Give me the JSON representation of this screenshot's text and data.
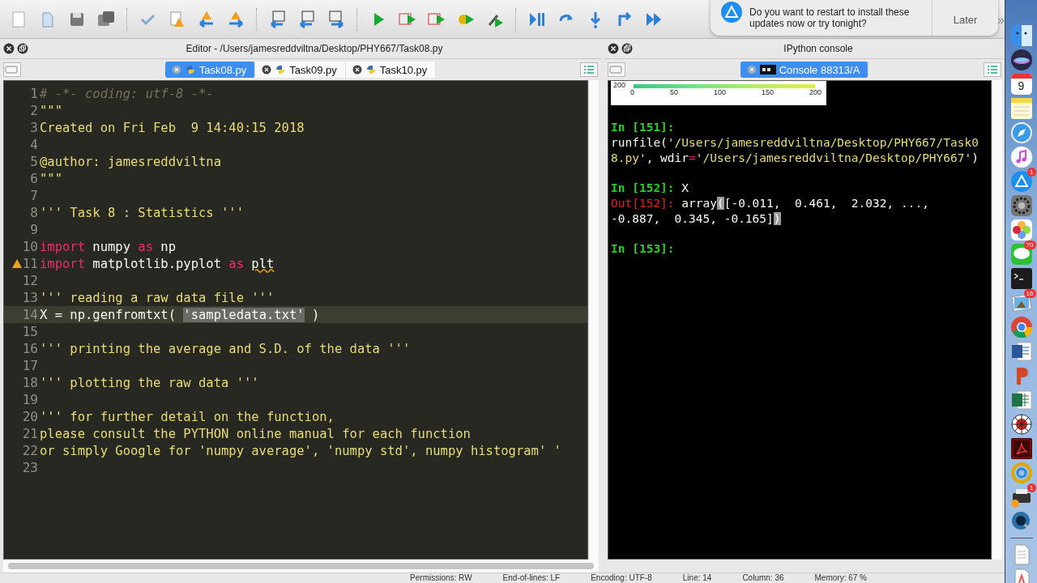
{
  "toolbar": {
    "overflow": "»"
  },
  "notification": {
    "message": "Do you want to restart to install these updates now or try tonight?",
    "button": "Later"
  },
  "editor": {
    "title": "Editor - /Users/jamesreddviltna/Desktop/PHY667/Task08.py",
    "tabs": [
      {
        "label": "Task08.py",
        "selected": true
      },
      {
        "label": "Task09.py",
        "selected": false
      },
      {
        "label": "Task10.py",
        "selected": false
      }
    ],
    "lines": [
      {
        "number": "1",
        "warning": false,
        "current": false,
        "segments": [
          {
            "kind": "comment",
            "text": "# -*- coding: utf-8 -*-"
          }
        ]
      },
      {
        "number": "2",
        "warning": false,
        "current": false,
        "segments": [
          {
            "kind": "string",
            "text": "\"\"\""
          }
        ]
      },
      {
        "number": "3",
        "warning": false,
        "current": false,
        "segments": [
          {
            "kind": "string",
            "text": "Created on Fri Feb  9 14:40:15 2018"
          }
        ]
      },
      {
        "number": "4",
        "warning": false,
        "current": false
      },
      {
        "number": "5",
        "warning": false,
        "current": false,
        "segments": [
          {
            "kind": "string",
            "text": "@author: jamesreddviltna"
          }
        ]
      },
      {
        "number": "6",
        "warning": false,
        "current": false,
        "segments": [
          {
            "kind": "string",
            "text": "\"\"\""
          }
        ]
      },
      {
        "number": "7",
        "warning": false,
        "current": false
      },
      {
        "number": "8",
        "warning": false,
        "current": false,
        "segments": [
          {
            "kind": "string",
            "text": "''' Task 8 : Statistics '''"
          }
        ]
      },
      {
        "number": "9",
        "warning": false,
        "current": false
      },
      {
        "number": "10",
        "warning": false,
        "current": false,
        "segments": [
          {
            "kind": "keyword",
            "text": "import"
          },
          {
            "kind": "plain",
            "text": " numpy "
          },
          {
            "kind": "keyword",
            "text": "as"
          },
          {
            "kind": "plain",
            "text": " np"
          }
        ]
      },
      {
        "number": "11",
        "warning": true,
        "current": false,
        "segments": [
          {
            "kind": "keyword",
            "text": "import"
          },
          {
            "kind": "plain",
            "text": " matplotlib.pyplot "
          },
          {
            "kind": "keyword",
            "text": "as "
          },
          {
            "kind": "flagged",
            "text": "plt"
          }
        ]
      },
      {
        "number": "12",
        "warning": false,
        "current": false
      },
      {
        "number": "13",
        "warning": false,
        "current": false,
        "segments": [
          {
            "kind": "string",
            "text": "''' reading a raw data file '''"
          }
        ]
      },
      {
        "number": "14",
        "warning": false,
        "current": true,
        "segments": [
          {
            "kind": "plain",
            "text": "X = np.genfromtxt( "
          },
          {
            "kind": "selection",
            "text": "'sampledata.txt'"
          },
          {
            "kind": "plain",
            "text": " )"
          }
        ]
      },
      {
        "number": "15",
        "warning": false,
        "current": false
      },
      {
        "number": "16",
        "warning": false,
        "current": false,
        "segments": [
          {
            "kind": "string",
            "text": "''' printing the average and S.D. of the data '''"
          }
        ]
      },
      {
        "number": "17",
        "warning": false,
        "current": false
      },
      {
        "number": "18",
        "warning": false,
        "current": false,
        "segments": [
          {
            "kind": "string",
            "text": "''' plotting the raw data '''"
          }
        ]
      },
      {
        "number": "19",
        "warning": false,
        "current": false
      },
      {
        "number": "20",
        "warning": false,
        "current": false,
        "segments": [
          {
            "kind": "string",
            "text": "''' for further detail on the function,"
          }
        ]
      },
      {
        "number": "21",
        "warning": false,
        "current": false,
        "segments": [
          {
            "kind": "string",
            "text": "please consult the PYTHON online manual for each function"
          }
        ]
      },
      {
        "number": "22",
        "warning": false,
        "current": false,
        "segments": [
          {
            "kind": "string",
            "text": "or simply Google for 'numpy average', 'numpy std', numpy histogram' '"
          }
        ]
      },
      {
        "number": "23",
        "warning": false,
        "current": false
      }
    ]
  },
  "console": {
    "title": "IPython console",
    "tabs": [
      {
        "label": "Console 88313/A",
        "selected": true
      }
    ],
    "plot_fragment": {
      "ytick": "200",
      "xticks": [
        "0",
        "50",
        "100",
        "150",
        "200"
      ]
    },
    "blocks": [
      {
        "lines": [
          [
            {
              "kind": "in_prompt",
              "text": "In [151]:"
            }
          ],
          [
            {
              "kind": "plain",
              "text": "runfile("
            },
            {
              "kind": "string",
              "text": "'/Users/jamesreddviltna/Desktop/PHY667/Task0"
            }
          ],
          [
            {
              "kind": "string",
              "text": "8.py'"
            },
            {
              "kind": "plain",
              "text": ", wdir"
            },
            {
              "kind": "operator",
              "text": "="
            },
            {
              "kind": "string",
              "text": "'/Users/jamesreddviltna/Desktop/PHY667'"
            },
            {
              "kind": "plain",
              "text": ")"
            }
          ]
        ]
      },
      {
        "lines": [
          [
            {
              "kind": "in_prompt",
              "text": "In [152]:"
            },
            {
              "kind": "plain",
              "text": " X"
            }
          ],
          [
            {
              "kind": "out_prompt",
              "text": "Out[152]:"
            },
            {
              "kind": "plain",
              "text": " array"
            },
            {
              "kind": "match",
              "text": "("
            },
            {
              "kind": "plain",
              "text": "[-0.011,  0.461,  2.032, ...,"
            }
          ],
          [
            {
              "kind": "plain",
              "text": "-0.887,  0.345, -0.165]"
            },
            {
              "kind": "match",
              "text": ")"
            }
          ]
        ]
      },
      {
        "lines": [
          [
            {
              "kind": "in_prompt",
              "text": "In [153]:"
            }
          ]
        ]
      }
    ]
  },
  "status_bar": [
    "Permissions: RW",
    "End-of-lines: LF",
    "Encoding: UTF-8",
    "Line: 14",
    "Column: 36",
    "Memory: 67 %"
  ],
  "dock": [
    {
      "kind": "finder"
    },
    {
      "kind": "siri"
    },
    {
      "kind": "calendar",
      "date": "9"
    },
    {
      "kind": "notes"
    },
    {
      "kind": "safari"
    },
    {
      "kind": "music"
    },
    {
      "kind": "appstore",
      "badge": "1"
    },
    {
      "kind": "prefs"
    },
    {
      "kind": "photos"
    },
    {
      "kind": "chat",
      "badge": "70"
    },
    {
      "kind": "terminal"
    },
    {
      "kind": "preview",
      "badge": "16"
    },
    {
      "kind": "browser"
    },
    {
      "kind": "word"
    },
    {
      "kind": "slides"
    },
    {
      "kind": "sheet"
    },
    {
      "kind": "web"
    },
    {
      "kind": "pdf"
    },
    {
      "kind": "swirl"
    },
    {
      "kind": "printer",
      "badge": "1"
    },
    {
      "kind": "player"
    },
    {
      "kind": "divider"
    },
    {
      "kind": "file"
    },
    {
      "kind": "file2"
    }
  ]
}
